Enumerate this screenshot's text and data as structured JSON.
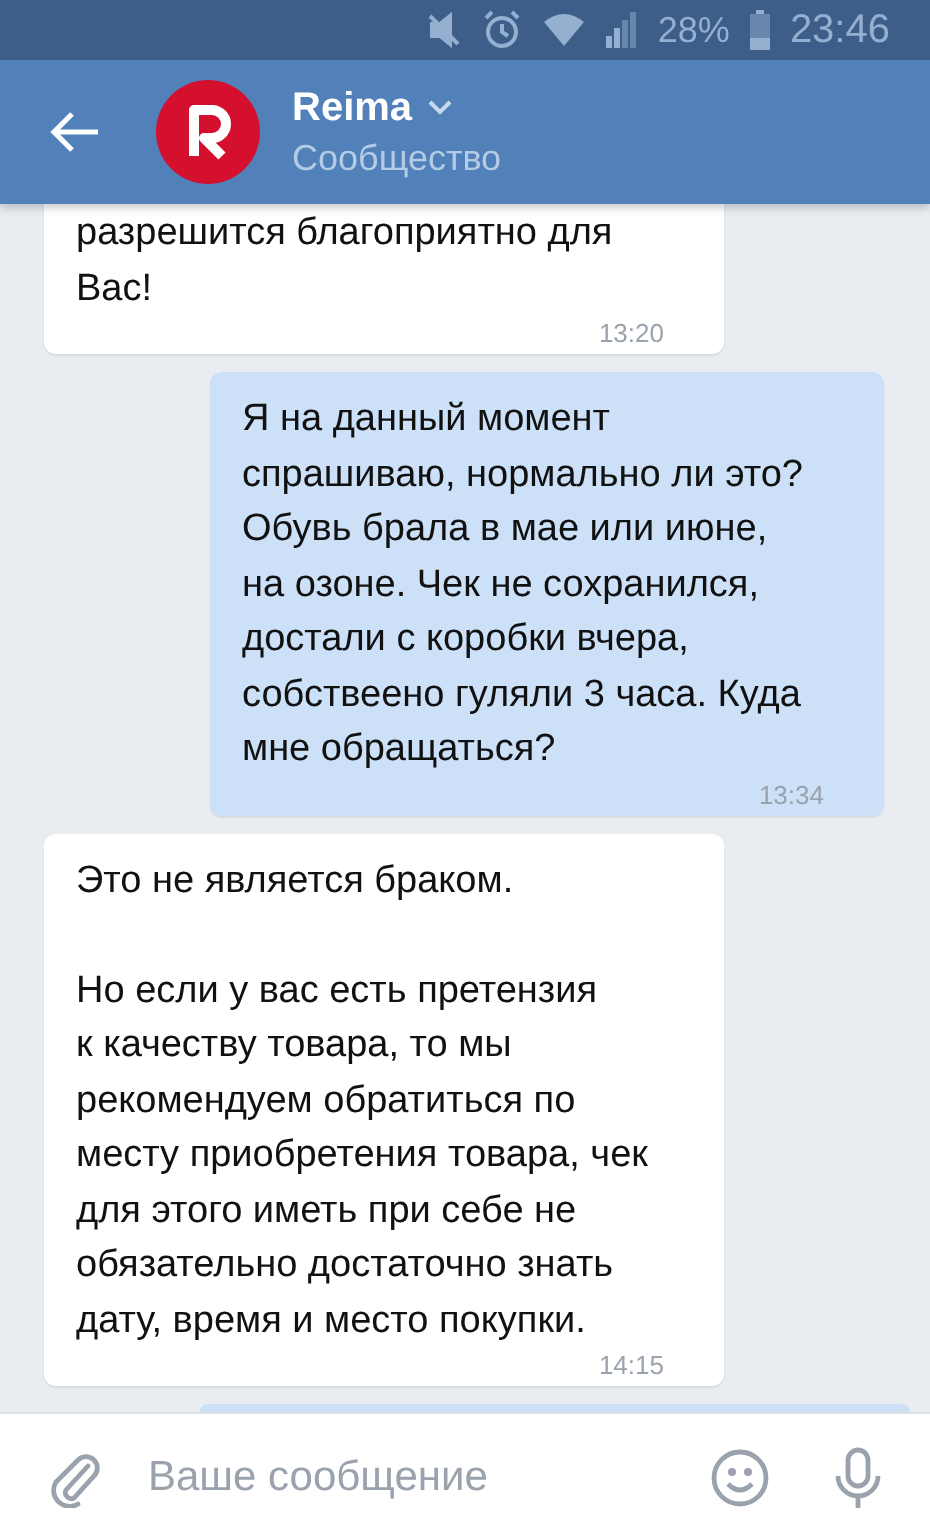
{
  "status_bar": {
    "battery": "28%",
    "time": "23:46"
  },
  "header": {
    "title": "Reima",
    "subtitle": "Сообщество"
  },
  "messages": [
    {
      "outgoing": false,
      "paragraphs": [
        "разрешится благоприятно для\nВас!"
      ],
      "time": "13:20"
    },
    {
      "outgoing": true,
      "paragraphs": [
        "Я на данный момент\nспрашиваю, нормально ли это?\nОбувь брала в мае или июне,\nна озоне. Чек не сохранился,\nдостали с коробки вчера,\nсобствеено гуляли 3 часа. Куда\nмне обращаться?"
      ],
      "time": "13:34"
    },
    {
      "outgoing": false,
      "paragraphs": [
        "Это не является браком.",
        "Но если у вас есть претензия\nк качеству товара, то мы\nрекомендуем обратиться по\nместу приобретения товара, чек\nдля этого иметь при себе не\nобязательно достаточно знать\nдату, время и место покупки."
      ],
      "time": "14:15"
    }
  ],
  "composer": {
    "placeholder": "Ваше сообщение"
  }
}
